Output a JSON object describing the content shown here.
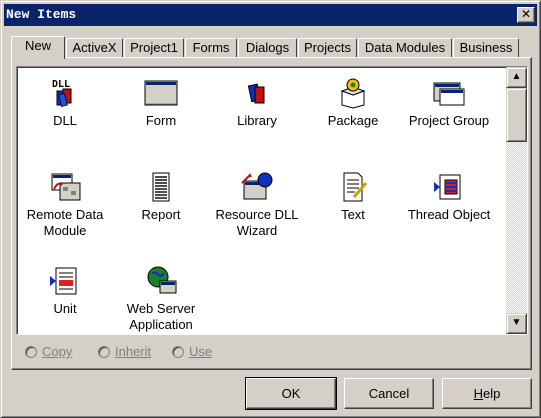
{
  "window": {
    "title": "New Items",
    "close_glyph": "✕"
  },
  "tabs": [
    {
      "label": "New",
      "active": true
    },
    {
      "label": "ActiveX"
    },
    {
      "label": "Project1"
    },
    {
      "label": "Forms"
    },
    {
      "label": "Dialogs"
    },
    {
      "label": "Projects"
    },
    {
      "label": "Data Modules"
    },
    {
      "label": "Business"
    }
  ],
  "items": [
    {
      "label": "DLL",
      "icon": "dll-icon"
    },
    {
      "label": "Form",
      "icon": "form-icon"
    },
    {
      "label": "Library",
      "icon": "library-icon"
    },
    {
      "label": "Package",
      "icon": "package-icon"
    },
    {
      "label": "Project Group",
      "icon": "project-group-icon"
    },
    {
      "label": "Remote Data\nModule",
      "icon": "remote-data-module-icon"
    },
    {
      "label": "Report",
      "icon": "report-icon"
    },
    {
      "label": "Resource DLL\nWizard",
      "icon": "resource-dll-wizard-icon"
    },
    {
      "label": "Text",
      "icon": "text-icon"
    },
    {
      "label": "Thread Object",
      "icon": "thread-object-icon"
    },
    {
      "label": "Unit",
      "icon": "unit-icon"
    },
    {
      "label": "Web Server\nApplication",
      "icon": "web-server-application-icon"
    }
  ],
  "options": {
    "copy": "Copy",
    "inherit": "Inherit",
    "use": "Use",
    "enabled": false
  },
  "buttons": {
    "ok": "OK",
    "cancel": "Cancel",
    "help_prefix": "H",
    "help_rest": "elp"
  },
  "scrollbar": {
    "up_glyph": "▲",
    "down_glyph": "▼"
  },
  "dll_icon_text": "DLL"
}
